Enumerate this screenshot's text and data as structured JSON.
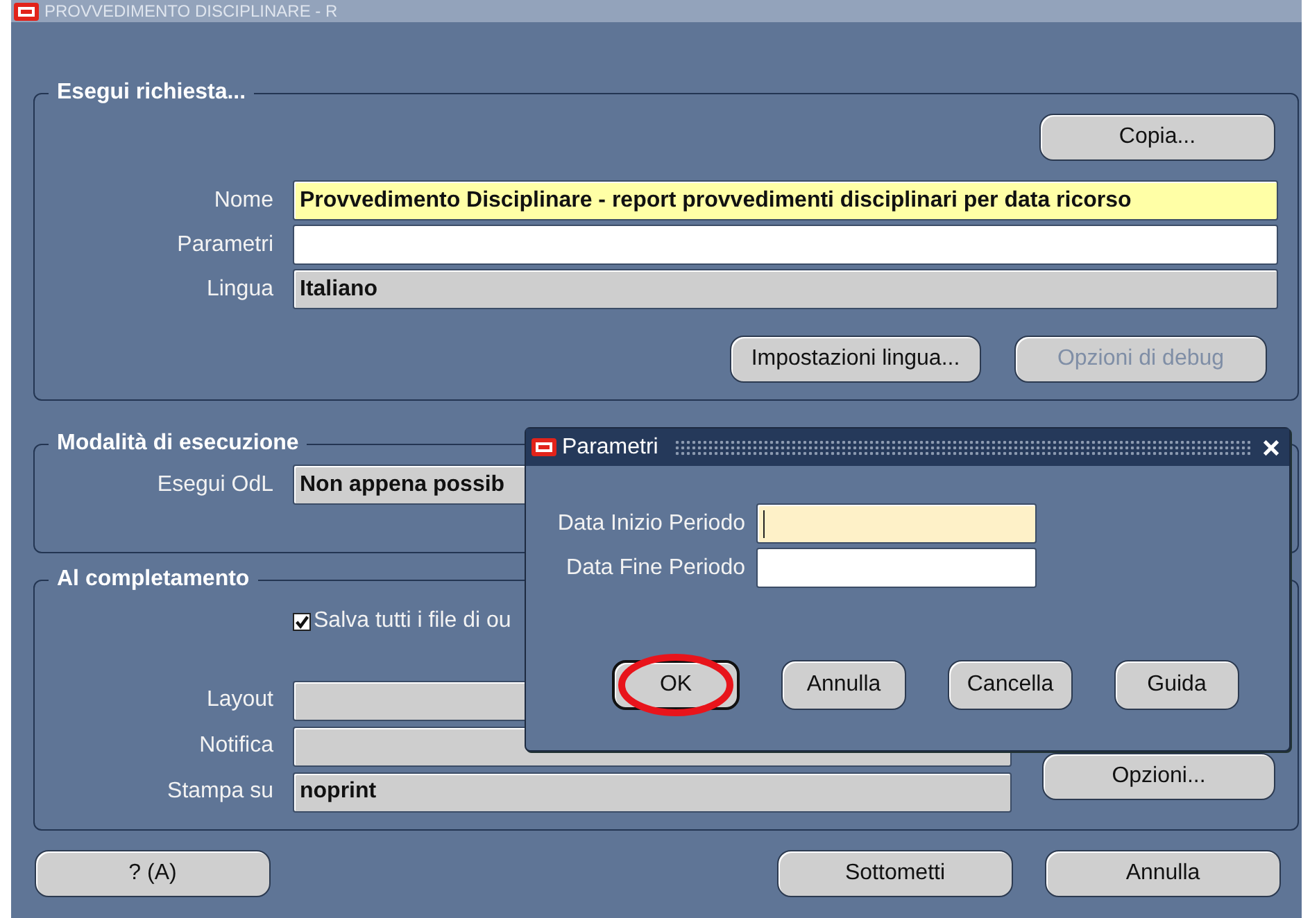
{
  "window": {
    "title": "PROVVEDIMENTO DISCIPLINARE - R"
  },
  "request": {
    "heading": "Esegui richiesta...",
    "copy_button": {
      "label": "Copia..."
    },
    "fields": [
      {
        "label": "Nome",
        "value": "Provvedimento Disciplinare - report provvedimenti disciplinari per data ricorso",
        "kind": "required"
      },
      {
        "label": "Parametri",
        "kind": "editable"
      },
      {
        "label": "Lingua",
        "value": "Italiano",
        "kind": "readonly"
      }
    ],
    "buttons": [
      {
        "label": "Impostazioni lingua...",
        "disabled": false
      },
      {
        "label": "Opzioni di debug",
        "disabled": true
      }
    ]
  },
  "schedule": {
    "heading": "Modalità di esecuzione",
    "fields": [
      {
        "label": "Esegui OdL",
        "value": "Non appena possib",
        "kind": "readonly"
      }
    ]
  },
  "completion": {
    "heading": "Al completamento",
    "save_checkbox": {
      "label": "Salva tutti i file di ou",
      "checked": true
    },
    "fields": [
      {
        "label": "Layout",
        "kind": "readonly"
      },
      {
        "label": "Notifica",
        "kind": "readonly"
      },
      {
        "label": "Stampa su",
        "value": "noprint",
        "kind": "readonly"
      }
    ],
    "options_button": {
      "label": "Opzioni..."
    }
  },
  "footer_buttons": [
    {
      "label": "? (A)"
    },
    {
      "label": "Sottometti"
    },
    {
      "label": "Annulla"
    }
  ],
  "dialog": {
    "title": "Parametri",
    "fields": [
      {
        "label": "Data Inizio Periodo",
        "kind": "focused"
      },
      {
        "label": "Data Fine Periodo",
        "kind": "editable"
      }
    ],
    "buttons": [
      {
        "label": "OK",
        "default": true,
        "highlighted": true
      },
      {
        "label": "Annulla",
        "default": false,
        "highlighted": false
      },
      {
        "label": "Cancella",
        "default": false,
        "highlighted": false
      },
      {
        "label": "Guida",
        "default": false,
        "highlighted": false
      }
    ]
  }
}
